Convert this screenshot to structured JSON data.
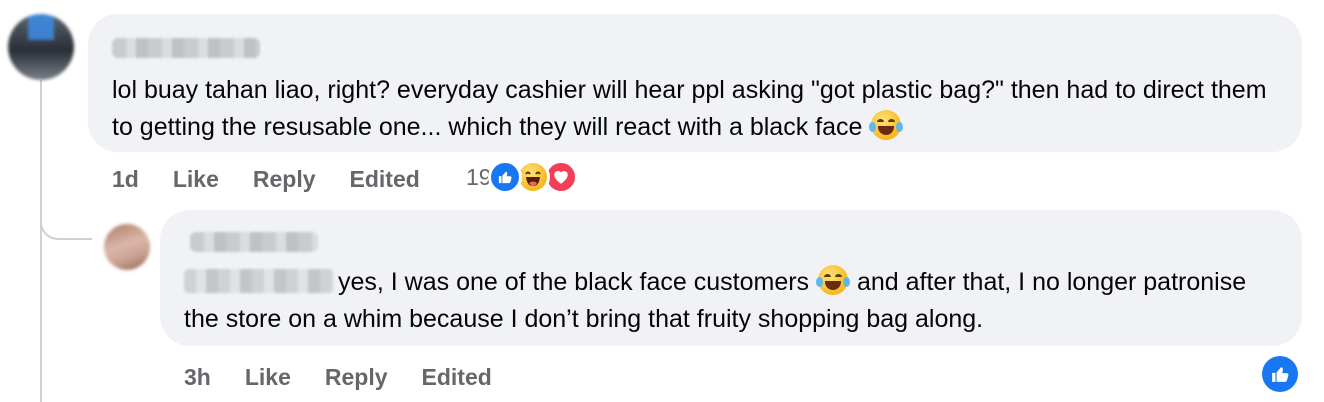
{
  "comments": [
    {
      "text": "lol buay tahan liao, right? everyday cashier will hear ppl asking \"got plastic bag?\" then had to direct them to getting the resusable one... which they will react with a black face",
      "emoji": "face-with-tears-of-joy-icon",
      "actions": {
        "time": "1d",
        "like": "Like",
        "reply": "Reply",
        "edited": "Edited"
      },
      "reaction_count": "19",
      "reactions": [
        "like",
        "haha",
        "love"
      ]
    },
    {
      "text_before": "yes, I was one of the black face customers",
      "text_after": "and after that, I no longer patronise the store on a whim because I don’t bring that fruity shopping bag along.",
      "emoji": "face-with-tears-of-joy-icon",
      "actions": {
        "time": "3h",
        "like": "Like",
        "reply": "Reply",
        "edited": "Edited"
      },
      "reaction": "like"
    }
  ],
  "colors": {
    "bubble": "#f0f2f5",
    "meta_text": "#65676b",
    "like_blue": "#1877f2",
    "love_red": "#f33e58"
  }
}
